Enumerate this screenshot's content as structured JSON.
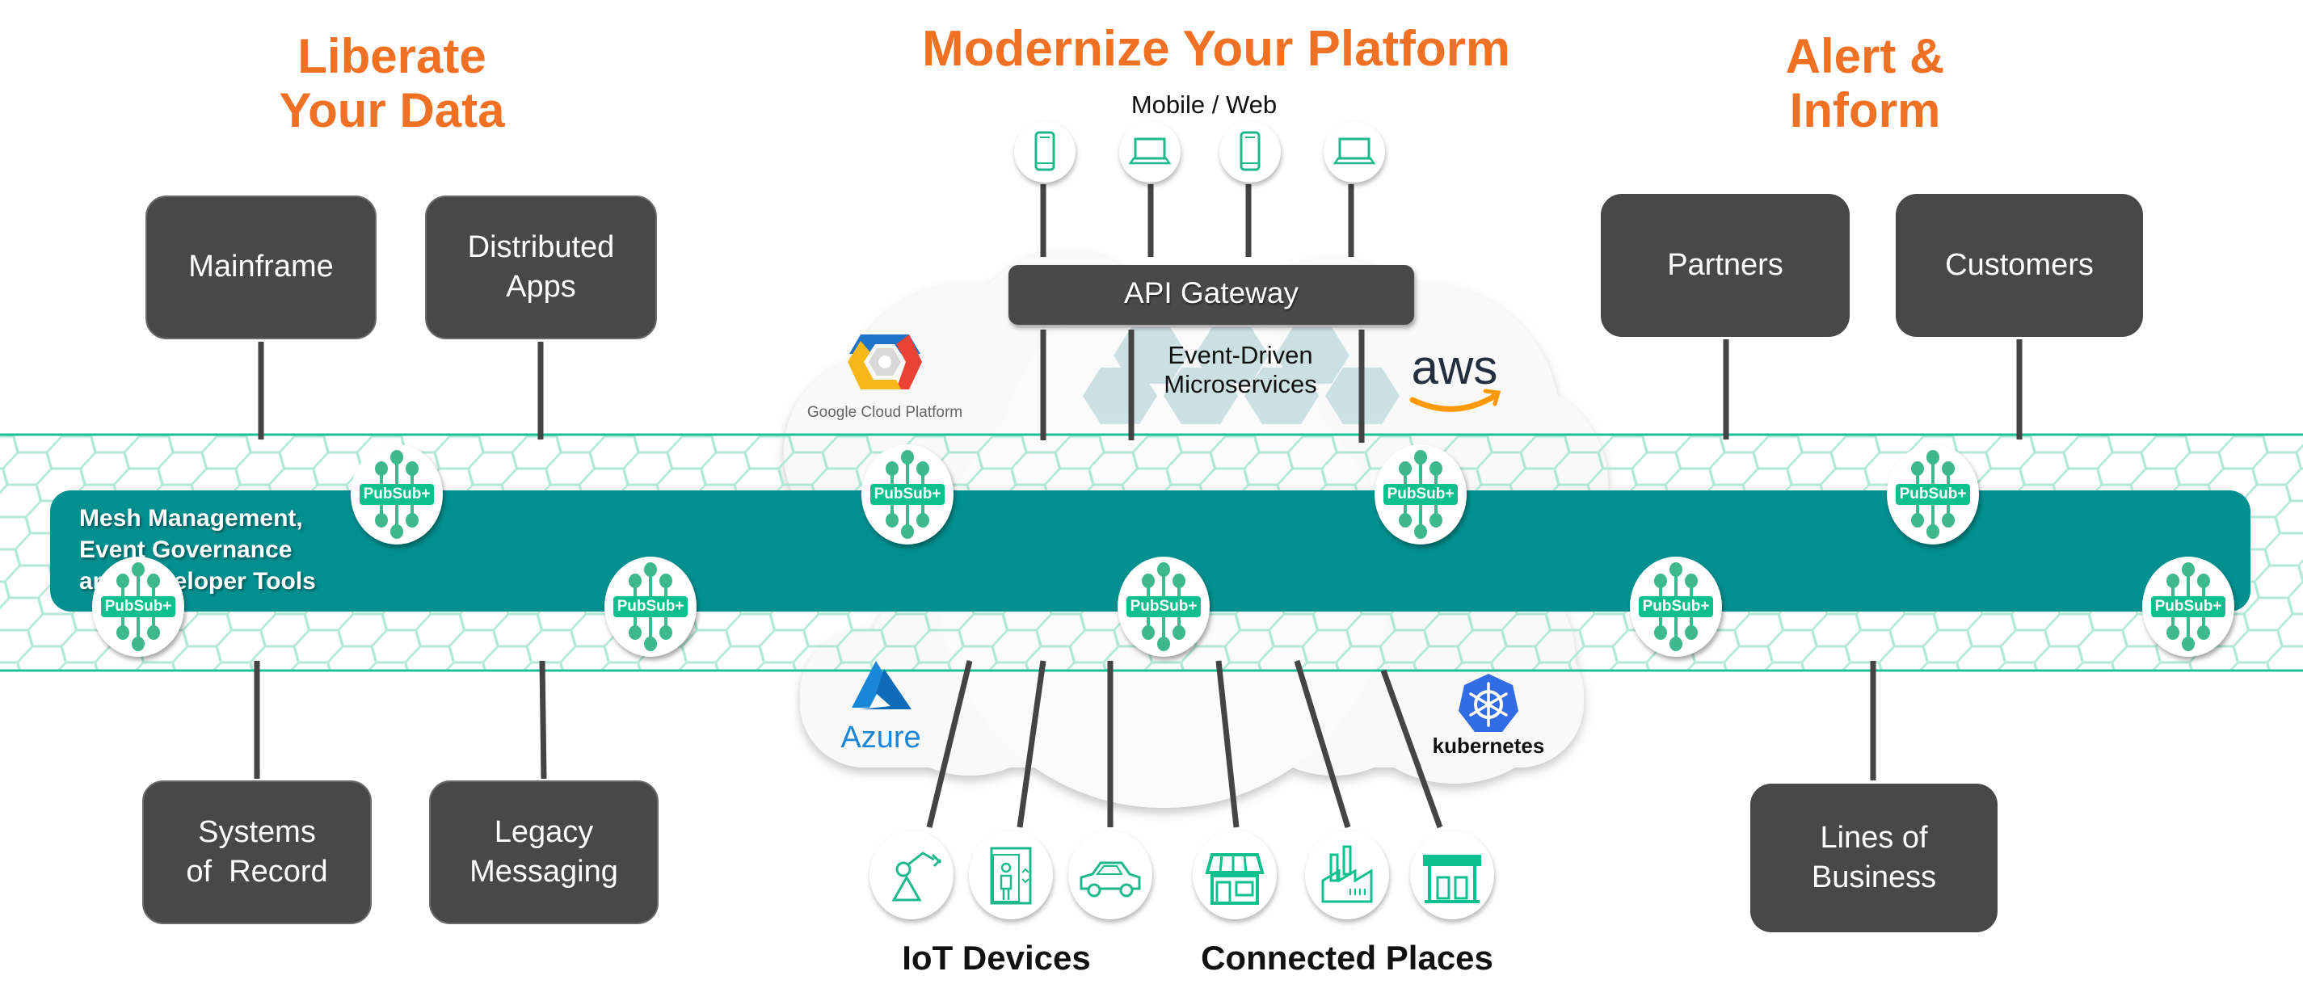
{
  "colors": {
    "accent_orange": "#F07124",
    "box_dark": "#484848",
    "mesh_teal": "#009090",
    "pubsub_green": "#0FC08E",
    "hex_line": "#9FE3CF",
    "arrow": "#444444"
  },
  "sections": {
    "liberate": {
      "line1": "Liberate",
      "line2": "Your Data"
    },
    "modernize": {
      "title": "Modernize Your Platform",
      "subtitle": "Mobile / Web"
    },
    "alert": {
      "line1": "Alert &",
      "line2": "Inform"
    }
  },
  "boxes": {
    "mainframe": {
      "lines": [
        "Mainframe"
      ]
    },
    "distributed_apps": {
      "lines": [
        "Distributed",
        "Apps"
      ]
    },
    "systems_of_record": {
      "lines": [
        "Systems",
        "of  Record"
      ]
    },
    "legacy_messaging": {
      "lines": [
        "Legacy",
        "Messaging"
      ]
    },
    "partners": {
      "lines": [
        "Partners"
      ]
    },
    "customers": {
      "lines": [
        "Customers"
      ]
    },
    "lines_of_business": {
      "lines": [
        "Lines of",
        "Business"
      ]
    },
    "api_gateway": {
      "lines": [
        "API Gateway"
      ]
    }
  },
  "mesh": {
    "label_lines": [
      "Mesh Management,",
      "Event Governance",
      "and Developer Tools"
    ],
    "node_label": "PubSub+",
    "node_count": 9
  },
  "microservices": {
    "line1": "Event-Driven",
    "line2": "Microservices"
  },
  "clouds": {
    "gcp": "Google Cloud Platform",
    "aws": "aws",
    "azure": "Azure",
    "kubernetes": "kubernetes"
  },
  "mobile_web_devices": [
    "phone-icon",
    "laptop-icon",
    "phone-icon",
    "laptop-icon"
  ],
  "iot_devices": {
    "label": "IoT Devices",
    "icons": [
      "robot-arm-icon",
      "elevator-icon",
      "car-icon"
    ]
  },
  "connected_places": {
    "label": "Connected Places",
    "icons": [
      "storefront-icon",
      "factory-icon",
      "gas-station-icon"
    ]
  }
}
